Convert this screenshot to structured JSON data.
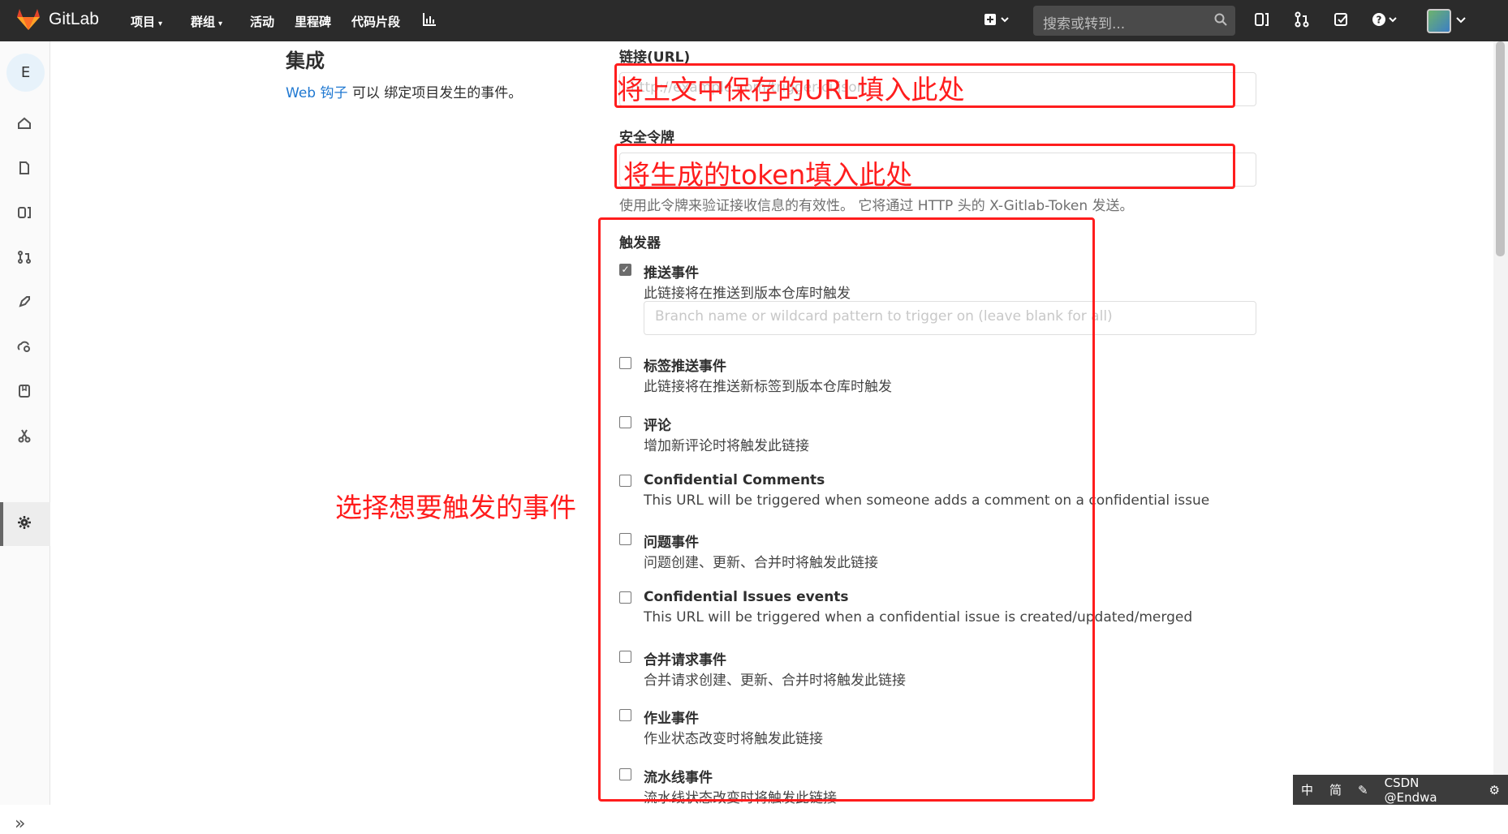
{
  "topbar": {
    "brand": "GitLab",
    "nav": [
      {
        "label": "项目",
        "has_dropdown": true
      },
      {
        "label": "群组",
        "has_dropdown": true
      },
      {
        "label": "活动",
        "has_dropdown": false
      },
      {
        "label": "里程碑",
        "has_dropdown": false
      },
      {
        "label": "代码片段",
        "has_dropdown": false
      }
    ],
    "search_placeholder": "搜索或转到..."
  },
  "sidebar": {
    "project_initial": "E",
    "icons": [
      "home-icon",
      "file-icon",
      "issues-icon",
      "merge-request-icon",
      "rocket-icon",
      "operations-icon",
      "wiki-icon",
      "snippets-icon",
      "settings-icon"
    ]
  },
  "page": {
    "title": "集成",
    "subtitle_link": "Web 钩子",
    "subtitle_rest": " 可以 绑定项目发生的事件。"
  },
  "form": {
    "url_label": "链接(URL)",
    "url_placeholder": "http://example.com/trigger-ci.json",
    "token_label": "安全令牌",
    "token_help": "使用此令牌来验证接收信息的有效性。 它将通过 HTTP 头的 X-Gitlab-Token 发送。",
    "triggers_label": "触发器",
    "branch_placeholder": "Branch name or wildcard pattern to trigger on (leave blank for all)",
    "events": [
      {
        "title": "推送事件",
        "desc": "此链接将在推送到版本仓库时触发",
        "checked": true
      },
      {
        "title": "标签推送事件",
        "desc": "此链接将在推送新标签到版本仓库时触发",
        "checked": false
      },
      {
        "title": "评论",
        "desc": "增加新评论时将触发此链接",
        "checked": false
      },
      {
        "title": "Confidential Comments",
        "desc": "This URL will be triggered when someone adds a comment on a confidential issue",
        "checked": false
      },
      {
        "title": "问题事件",
        "desc": "问题创建、更新、合并时将触发此链接",
        "checked": false
      },
      {
        "title": "Confidential Issues events",
        "desc": "This URL will be triggered when a confidential issue is created/updated/merged",
        "checked": false
      },
      {
        "title": "合并请求事件",
        "desc": "合并请求创建、更新、合并时将触发此链接",
        "checked": false
      },
      {
        "title": "作业事件",
        "desc": "作业状态改变时将触发此链接",
        "checked": false
      },
      {
        "title": "流水线事件",
        "desc": "流水线状态改变时将触发此链接",
        "checked": false
      }
    ]
  },
  "annotations": {
    "url_note": "将上文中保存的URL填入此处",
    "token_note": "将生成的token填入此处",
    "events_note": "选择想要触发的事件"
  },
  "ime_bar": {
    "items": [
      "中",
      "简",
      "CSDN @Endwa"
    ]
  },
  "colors": {
    "topbar": "#2b2b2b",
    "annotation": "#ff1d1d",
    "link": "#1f78d1"
  }
}
